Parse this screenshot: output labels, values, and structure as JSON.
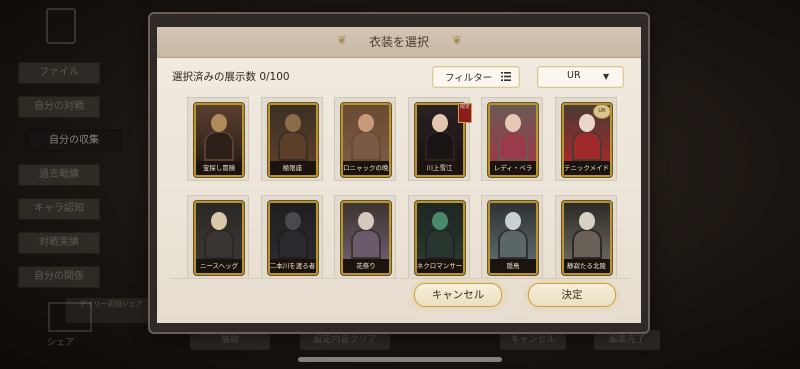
{
  "background": {
    "side_nav": [
      "ファイル",
      "自分の対戦",
      "自分の収集",
      "過去戦績",
      "キャラ認知",
      "対戦実績",
      "自分の関係"
    ],
    "active_index": 2,
    "daily_label": "デイリー初回シェア",
    "share_label": "シェア",
    "bottom_buttons": [
      "展開",
      "設定内容クリア",
      "キャンセル",
      "編集完了"
    ]
  },
  "modal": {
    "title": "衣装を選択",
    "count_label": "選択済みの展示数 0/100",
    "filter_label": "フィルター",
    "grade_label": "UR",
    "cancel_label": "キャンセル",
    "confirm_label": "決定"
  },
  "cards": [
    {
      "name": "宝探し冒険",
      "palette": [
        "#5a4030",
        "#b08a5a",
        "#2c1f18"
      ]
    },
    {
      "name": "極限座",
      "palette": [
        "#3b2f25",
        "#8b6b48",
        "#5a3e28"
      ]
    },
    {
      "name": "ロニャックの晩歌",
      "palette": [
        "#6a4a32",
        "#c89a7a",
        "#7a5a44"
      ]
    },
    {
      "name": "川上雪江",
      "palette": [
        "#2b2222",
        "#e3c6b0",
        "#1a1414"
      ]
    },
    {
      "name": "レディ・ペラ",
      "palette": [
        "#6a5a55",
        "#e6c9b5",
        "#9a3a4a"
      ]
    },
    {
      "name": "テニックメイド",
      "palette": [
        "#4a3a36",
        "#e9d7cb",
        "#a02a2a"
      ]
    },
    {
      "name": "ニースヘッグ",
      "palette": [
        "#2a2826",
        "#d9c9a8",
        "#3a3532"
      ]
    },
    {
      "name": "二本川を渡る者",
      "palette": [
        "#1f1e20",
        "#4a4a4e",
        "#2a2a2e"
      ]
    },
    {
      "name": "花祭り",
      "palette": [
        "#3c342f",
        "#d6c8bf",
        "#6a5a6a"
      ]
    },
    {
      "name": "ネクロマンサー",
      "palette": [
        "#1e2622",
        "#4a8a6a",
        "#2a3630"
      ]
    },
    {
      "name": "隠鳥",
      "palette": [
        "#2f3234",
        "#c8d0d0",
        "#5a6668"
      ]
    },
    {
      "name": "静寂たる北陵",
      "palette": [
        "#2c2a28",
        "#d8d0c4",
        "#6a6258"
      ]
    }
  ],
  "badges": {
    "new_tag": "限定",
    "ur_tag": "UR"
  },
  "colors": {
    "gold_border": "#b89333",
    "paper": "#efe8dc",
    "button_glow": "#e6be5a"
  }
}
